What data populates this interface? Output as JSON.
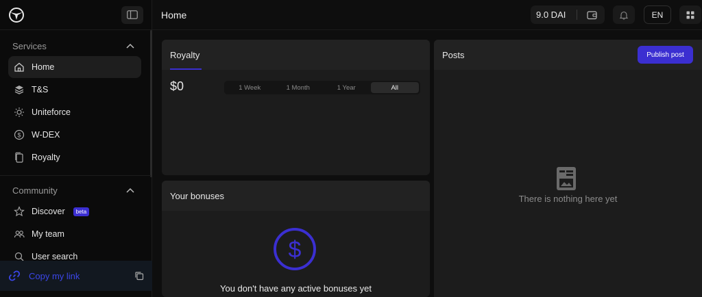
{
  "sidebar": {
    "sections": [
      {
        "title": "Services",
        "items": [
          {
            "label": "Home",
            "icon": "home-icon"
          },
          {
            "label": "T&S",
            "icon": "layers-icon"
          },
          {
            "label": "Uniteforce",
            "icon": "sun-icon"
          },
          {
            "label": "W-DEX",
            "icon": "coin-icon"
          },
          {
            "label": "Royalty",
            "icon": "files-icon"
          }
        ]
      },
      {
        "title": "Community",
        "items": [
          {
            "label": "Discover",
            "icon": "star-icon",
            "badge": "beta"
          },
          {
            "label": "My team",
            "icon": "users-icon"
          },
          {
            "label": "User search",
            "icon": "search-icon"
          }
        ]
      }
    ],
    "copy_link": "Copy my link"
  },
  "header": {
    "title": "Home",
    "balance": "9.0 DAI",
    "language": "EN"
  },
  "royalty": {
    "title": "Royalty",
    "amount": "$0",
    "periods": [
      "1 Week",
      "1 Month",
      "1 Year",
      "All"
    ],
    "selected_period": "All"
  },
  "bonuses": {
    "title": "Your bonuses",
    "empty_text": "You don't have any active bonuses yet"
  },
  "posts": {
    "title": "Posts",
    "publish_label": "Publish post",
    "empty_text": "There is nothing here yet"
  },
  "colors": {
    "accent": "#3b2fd1",
    "background": "#0e0e0e",
    "card": "#1c1c1c"
  }
}
